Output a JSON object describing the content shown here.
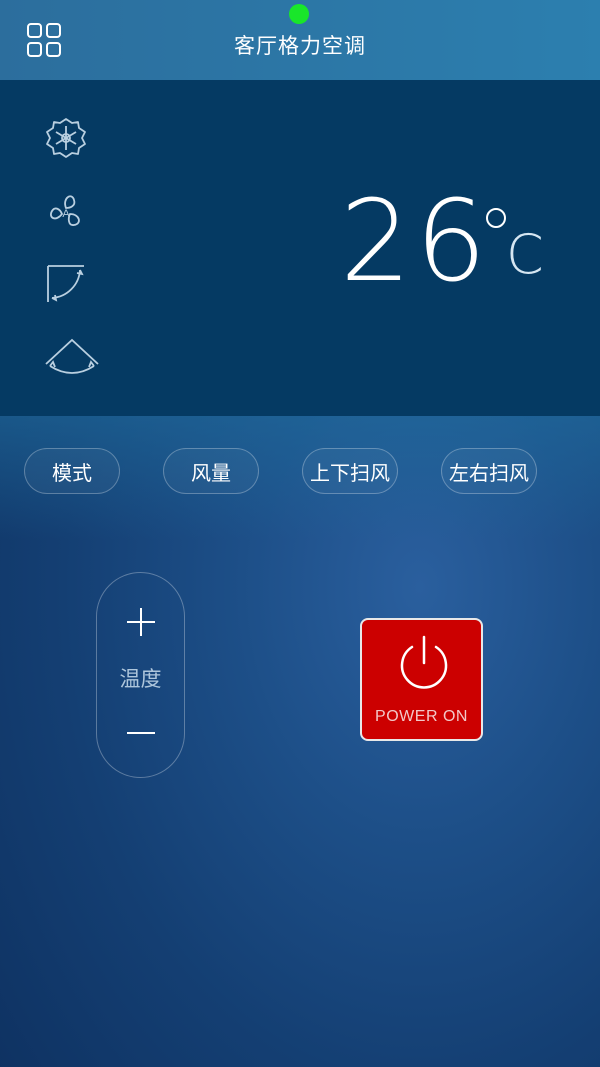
{
  "header": {
    "title": "客厅格力空调",
    "status_color": "#19e62a",
    "menu_icon": "grid-menu-icon"
  },
  "panel": {
    "mode_icons": [
      "snowflake-icon",
      "fan-auto-icon",
      "vertical-swing-icon",
      "horizontal-swing-icon"
    ],
    "temperature": "26",
    "unit": "C"
  },
  "controls": {
    "mode_label": "模式",
    "fan_speed_label": "风量",
    "vertical_swing_label": "上下扫风",
    "horizontal_swing_label": "左右扫风"
  },
  "temp_control": {
    "label": "温度"
  },
  "power": {
    "label": "POWER ON",
    "color": "#cc0000"
  }
}
